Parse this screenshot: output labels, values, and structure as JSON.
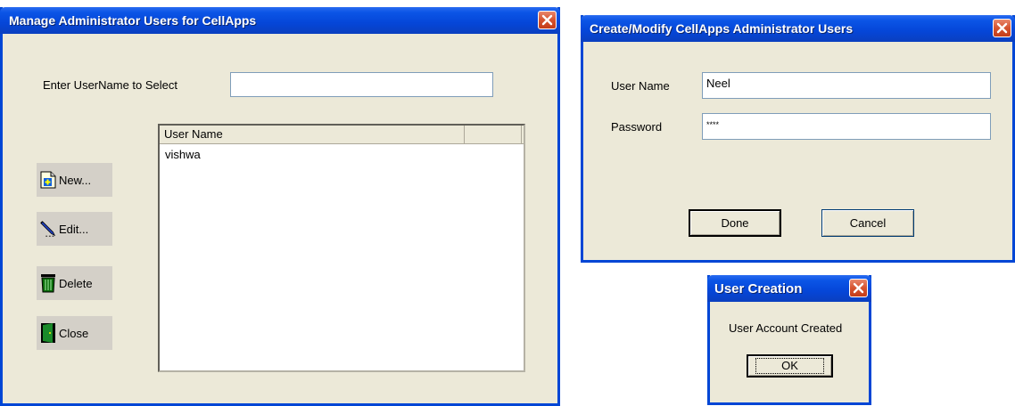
{
  "manage_window": {
    "title": "Manage Administrator Users for CellApps",
    "search_label": "Enter UserName to Select",
    "search_value": "",
    "list": {
      "columns": [
        "User Name",
        ""
      ],
      "rows": [
        "vishwa"
      ]
    },
    "buttons": {
      "new": "New...",
      "edit": "Edit...",
      "delete": "Delete",
      "close": "Close"
    }
  },
  "modify_window": {
    "title": "Create/Modify CellApps Administrator Users",
    "username_label": "User Name",
    "username_value": "Neel",
    "password_label": "Password",
    "password_value": "****",
    "done": "Done",
    "cancel": "Cancel"
  },
  "message_box": {
    "title": "User Creation",
    "message": "User Account Created",
    "ok": "OK"
  },
  "icons": {
    "new": "new-document-icon",
    "edit": "pencil-icon",
    "delete": "trash-icon",
    "close": "door-icon",
    "window_close": "close-icon"
  }
}
